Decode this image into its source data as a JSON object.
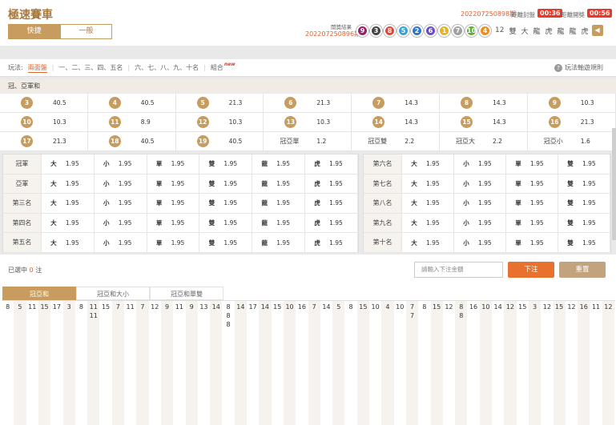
{
  "header": {
    "title": "極速賽車",
    "modes": [
      "快捷",
      "一般"
    ],
    "current_period": "202207250898期",
    "close_label": "距離封盤",
    "close_timer": "00:36",
    "open_label": "距離開獎",
    "open_timer": "00:56",
    "result_label": "開獎結果",
    "result_period": "202207250896期",
    "balls": [
      {
        "n": "9",
        "c": "#9c1f6b"
      },
      {
        "n": "3",
        "c": "#444444"
      },
      {
        "n": "8",
        "c": "#e84331"
      },
      {
        "n": "5",
        "c": "#3aa1d8"
      },
      {
        "n": "2",
        "c": "#2b79c9"
      },
      {
        "n": "6",
        "c": "#6a4cc4"
      },
      {
        "n": "1",
        "c": "#e8b21a"
      },
      {
        "n": "7",
        "c": "#a1a1a1"
      },
      {
        "n": "10",
        "c": "#5cb031"
      },
      {
        "n": "4",
        "c": "#f08b1e"
      }
    ],
    "extras": [
      "12",
      "雙",
      "大",
      "龍",
      "虎",
      "龍",
      "龍",
      "虎"
    ],
    "sound_icon": "speaker-icon"
  },
  "play": {
    "label": "玩法:",
    "items": [
      "兩面盤",
      "一、二、三、四、五名",
      "六、七、八、九、十名",
      "組合"
    ],
    "new_tag": "new",
    "rules": "玩法軸遊規則"
  },
  "sum_group": "冠、亞軍和",
  "sum_rows": [
    [
      {
        "n": "3",
        "o": "40.5"
      },
      {
        "n": "4",
        "o": "40.5"
      },
      {
        "n": "5",
        "o": "21.3"
      },
      {
        "n": "6",
        "o": "21.3"
      },
      {
        "n": "7",
        "o": "14.3"
      },
      {
        "n": "8",
        "o": "14.3"
      },
      {
        "n": "9",
        "o": "10.3"
      }
    ],
    [
      {
        "n": "10",
        "o": "10.3"
      },
      {
        "n": "11",
        "o": "8.9"
      },
      {
        "n": "12",
        "o": "10.3"
      },
      {
        "n": "13",
        "o": "10.3"
      },
      {
        "n": "14",
        "o": "14.3"
      },
      {
        "n": "15",
        "o": "14.3"
      },
      {
        "n": "16",
        "o": "21.3"
      }
    ],
    [
      {
        "n": "17",
        "o": "21.3"
      },
      {
        "n": "18",
        "o": "40.5"
      },
      {
        "n": "19",
        "o": "40.5"
      },
      {
        "t": "冠亞單",
        "o": "1.2"
      },
      {
        "t": "冠亞雙",
        "o": "2.2"
      },
      {
        "t": "冠亞大",
        "o": "2.2"
      },
      {
        "t": "冠亞小",
        "o": "1.6"
      }
    ]
  ],
  "left_rows": [
    {
      "label": "冠軍",
      "bets": [
        [
          "大",
          "1.95"
        ],
        [
          "小",
          "1.95"
        ],
        [
          "單",
          "1.95"
        ],
        [
          "雙",
          "1.95"
        ],
        [
          "龍",
          "1.95"
        ],
        [
          "虎",
          "1.95"
        ]
      ]
    },
    {
      "label": "亞軍",
      "bets": [
        [
          "大",
          "1.95"
        ],
        [
          "小",
          "1.95"
        ],
        [
          "單",
          "1.95"
        ],
        [
          "雙",
          "1.95"
        ],
        [
          "龍",
          "1.95"
        ],
        [
          "虎",
          "1.95"
        ]
      ]
    },
    {
      "label": "第三名",
      "bets": [
        [
          "大",
          "1.95"
        ],
        [
          "小",
          "1.95"
        ],
        [
          "單",
          "1.95"
        ],
        [
          "雙",
          "1.95"
        ],
        [
          "龍",
          "1.95"
        ],
        [
          "虎",
          "1.95"
        ]
      ]
    },
    {
      "label": "第四名",
      "bets": [
        [
          "大",
          "1.95"
        ],
        [
          "小",
          "1.95"
        ],
        [
          "單",
          "1.95"
        ],
        [
          "雙",
          "1.95"
        ],
        [
          "龍",
          "1.95"
        ],
        [
          "虎",
          "1.95"
        ]
      ]
    },
    {
      "label": "第五名",
      "bets": [
        [
          "大",
          "1.95"
        ],
        [
          "小",
          "1.95"
        ],
        [
          "單",
          "1.95"
        ],
        [
          "雙",
          "1.95"
        ],
        [
          "龍",
          "1.95"
        ],
        [
          "虎",
          "1.95"
        ]
      ]
    }
  ],
  "right_rows": [
    {
      "label": "第六名",
      "bets": [
        [
          "大",
          "1.95"
        ],
        [
          "小",
          "1.95"
        ],
        [
          "單",
          "1.95"
        ],
        [
          "雙",
          "1.95"
        ]
      ]
    },
    {
      "label": "第七名",
      "bets": [
        [
          "大",
          "1.95"
        ],
        [
          "小",
          "1.95"
        ],
        [
          "單",
          "1.95"
        ],
        [
          "雙",
          "1.95"
        ]
      ]
    },
    {
      "label": "第八名",
      "bets": [
        [
          "大",
          "1.95"
        ],
        [
          "小",
          "1.95"
        ],
        [
          "單",
          "1.95"
        ],
        [
          "雙",
          "1.95"
        ]
      ]
    },
    {
      "label": "第九名",
      "bets": [
        [
          "大",
          "1.95"
        ],
        [
          "小",
          "1.95"
        ],
        [
          "單",
          "1.95"
        ],
        [
          "雙",
          "1.95"
        ]
      ]
    },
    {
      "label": "第十名",
      "bets": [
        [
          "大",
          "1.95"
        ],
        [
          "小",
          "1.95"
        ],
        [
          "單",
          "1.95"
        ],
        [
          "雙",
          "1.95"
        ]
      ]
    }
  ],
  "actions": {
    "selected_prefix": "已選中",
    "selected_count": "0",
    "selected_suffix": "注",
    "amount_placeholder": "請輸入下注金額",
    "submit": "下注",
    "reset": "重置"
  },
  "road": {
    "tabs": [
      "冠亞和",
      "冠亞和大小",
      "冠亞和單雙"
    ],
    "columns": [
      [
        "8"
      ],
      [
        "5"
      ],
      [
        "11"
      ],
      [
        "15"
      ],
      [
        "17"
      ],
      [
        "3"
      ],
      [
        "8"
      ],
      [
        "11",
        "11"
      ],
      [
        "15"
      ],
      [
        "7"
      ],
      [
        "11"
      ],
      [
        "7"
      ],
      [
        "12"
      ],
      [
        "9"
      ],
      [
        "11"
      ],
      [
        "9"
      ],
      [
        "13"
      ],
      [
        "14"
      ],
      [
        "8",
        "8",
        "8"
      ],
      [
        "14"
      ],
      [
        "17"
      ],
      [
        "14"
      ],
      [
        "15"
      ],
      [
        "10"
      ],
      [
        "16"
      ],
      [
        "7"
      ],
      [
        "14"
      ],
      [
        "5"
      ],
      [
        "8"
      ],
      [
        "15"
      ],
      [
        "10"
      ],
      [
        "4"
      ],
      [
        "10"
      ],
      [
        "7",
        "7"
      ],
      [
        "8"
      ],
      [
        "15"
      ],
      [
        "12"
      ],
      [
        "8",
        "8"
      ],
      [
        "16"
      ],
      [
        "10"
      ],
      [
        "14"
      ],
      [
        "12"
      ],
      [
        "15"
      ],
      [
        "3"
      ],
      [
        "12"
      ],
      [
        "15"
      ],
      [
        "12"
      ],
      [
        "16"
      ],
      [
        "11"
      ],
      [
        "12"
      ]
    ]
  }
}
